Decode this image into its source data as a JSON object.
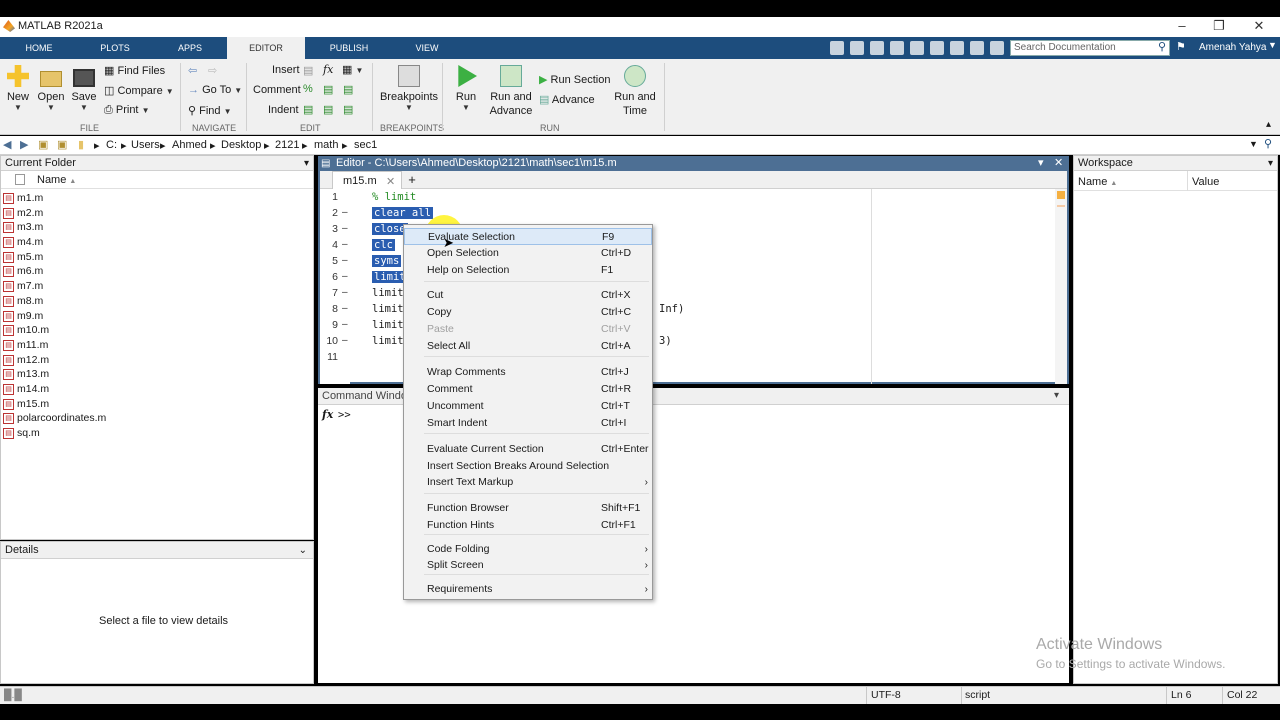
{
  "window": {
    "title": "MATLAB R2021a"
  },
  "tabs": [
    "HOME",
    "PLOTS",
    "APPS",
    "EDITOR",
    "PUBLISH",
    "VIEW"
  ],
  "search_placeholder": "Search Documentation",
  "user": "Amenah Yahya",
  "ribbon": {
    "new": "New",
    "open": "Open",
    "save": "Save",
    "find_files": "Find Files",
    "compare": "Compare",
    "print": "Print",
    "go_to": "Go To",
    "find": "Find",
    "insert": "Insert",
    "comment": "Comment",
    "indent": "Indent",
    "breakpoints": "Breakpoints",
    "run": "Run",
    "run_and_advance": [
      "Run and",
      "Advance"
    ],
    "run_section": "Run Section",
    "advance": "Advance",
    "run_and_time": [
      "Run and",
      "Time"
    ],
    "groups": [
      "FILE",
      "NAVIGATE",
      "EDIT",
      "BREAKPOINTS",
      "RUN"
    ]
  },
  "address": {
    "drive": "C:",
    "parts": [
      "Users",
      "Ahmed",
      "Desktop",
      "2121",
      "math",
      "sec1"
    ]
  },
  "current_folder": {
    "title": "Current Folder",
    "column": "Name",
    "files": [
      "m1.m",
      "m2.m",
      "m3.m",
      "m4.m",
      "m5.m",
      "m6.m",
      "m7.m",
      "m8.m",
      "m9.m",
      "m10.m",
      "m11.m",
      "m12.m",
      "m13.m",
      "m14.m",
      "m15.m",
      "polarcoordinates.m",
      "sq.m"
    ]
  },
  "details": {
    "title": "Details",
    "message": "Select a file to view details"
  },
  "editor": {
    "title": "Editor - C:\\Users\\Ahmed\\Desktop\\2121\\math\\sec1\\m15.m",
    "tab": "m15.m",
    "lines": [
      "% limit",
      "clear all",
      "close",
      "clc",
      "syms",
      "limit",
      "limit",
      "limit",
      "limit",
      "limit",
      ""
    ],
    "tail_8": "Inf)",
    "tail_10": "3)"
  },
  "command_window": {
    "title": "Command Window",
    "prompt": ">>"
  },
  "workspace": {
    "title": "Workspace",
    "col_name": "Name",
    "col_value": "Value"
  },
  "context_menu": [
    {
      "label": "Evaluate Selection",
      "shortcut": "F9"
    },
    {
      "label": "Open Selection",
      "shortcut": "Ctrl+D"
    },
    {
      "label": "Help on Selection",
      "shortcut": "F1"
    },
    {
      "label": "Cut",
      "shortcut": "Ctrl+X"
    },
    {
      "label": "Copy",
      "shortcut": "Ctrl+C"
    },
    {
      "label": "Paste",
      "shortcut": "Ctrl+V"
    },
    {
      "label": "Select All",
      "shortcut": "Ctrl+A"
    },
    {
      "label": "Wrap Comments",
      "shortcut": "Ctrl+J"
    },
    {
      "label": "Comment",
      "shortcut": "Ctrl+R"
    },
    {
      "label": "Uncomment",
      "shortcut": "Ctrl+T"
    },
    {
      "label": "Smart Indent",
      "shortcut": "Ctrl+I"
    },
    {
      "label": "Evaluate Current Section",
      "shortcut": "Ctrl+Enter"
    },
    {
      "label": "Insert Section Breaks Around Selection",
      "shortcut": ""
    },
    {
      "label": "Insert Text Markup",
      "shortcut": ""
    },
    {
      "label": "Function Browser",
      "shortcut": "Shift+F1"
    },
    {
      "label": "Function Hints",
      "shortcut": "Ctrl+F1"
    },
    {
      "label": "Code Folding",
      "shortcut": ""
    },
    {
      "label": "Split Screen",
      "shortcut": ""
    },
    {
      "label": "Requirements",
      "shortcut": ""
    }
  ],
  "status": {
    "encoding": "UTF-8",
    "type": "script",
    "ln": "Ln 6",
    "col": "Col 22"
  },
  "watermark": {
    "line1": "Activate Windows",
    "line2": "Go to Settings to activate Windows."
  },
  "colors": {
    "tabbar": "#1d4d7d",
    "editor_title": "#4d6f94",
    "selection": "#2a5db0",
    "comment": "#228b22"
  }
}
